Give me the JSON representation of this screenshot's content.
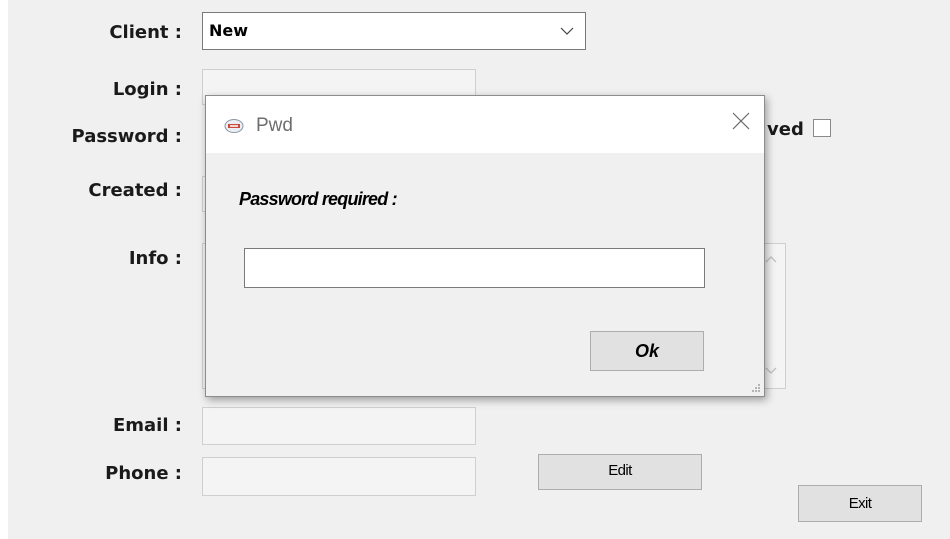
{
  "form": {
    "labels": {
      "client": "Client :",
      "login": "Login :",
      "password": "Password :",
      "created": "Created :",
      "info": "Info :",
      "email": "Email :",
      "phone": "Phone :"
    },
    "client_select": {
      "selected": "New"
    },
    "saved_partial_label": "ved",
    "edit_button": "Edit",
    "exit_button": "Exit",
    "login_value": "",
    "email_value": "",
    "phone_value": ""
  },
  "dialog": {
    "title": "Pwd",
    "prompt": "Password required :",
    "password_value": "",
    "ok_button": "Ok"
  }
}
